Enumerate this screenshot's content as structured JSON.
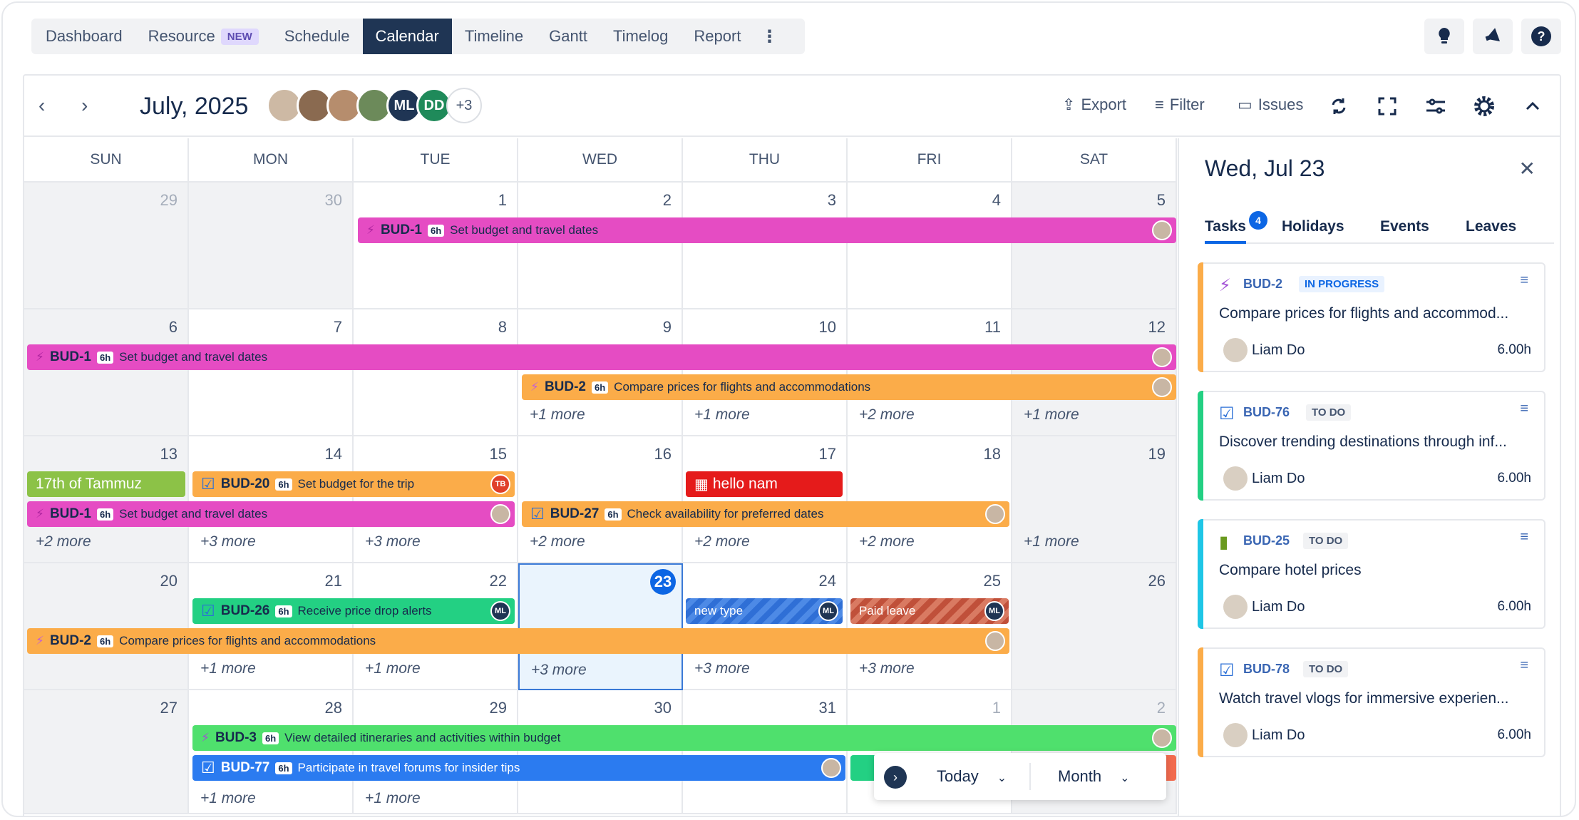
{
  "nav": {
    "items": [
      {
        "label": "Dashboard"
      },
      {
        "label": "Resource",
        "badge": "NEW"
      },
      {
        "label": "Schedule"
      },
      {
        "label": "Calendar",
        "active": true
      },
      {
        "label": "Timeline"
      },
      {
        "label": "Gantt"
      },
      {
        "label": "Timelog"
      },
      {
        "label": "Report"
      }
    ]
  },
  "header": {
    "title": "July, 2025",
    "more_avatars": "+3",
    "avatar_initials": [
      "ML",
      "DD"
    ],
    "export": "Export",
    "filter": "Filter",
    "issues": "Issues"
  },
  "days": [
    "SUN",
    "MON",
    "TUE",
    "WED",
    "THU",
    "FRI",
    "SAT"
  ],
  "weeks": [
    {
      "dates": [
        "29",
        "30",
        "1",
        "2",
        "3",
        "4",
        "5"
      ],
      "more": [
        "",
        "",
        "",
        "",
        "",
        "",
        ""
      ]
    },
    {
      "dates": [
        "6",
        "7",
        "8",
        "9",
        "10",
        "11",
        "12"
      ],
      "more": [
        "",
        "",
        "",
        "+1 more",
        "+1 more",
        "+2 more",
        "+1 more"
      ]
    },
    {
      "dates": [
        "13",
        "14",
        "15",
        "16",
        "17",
        "18",
        "19"
      ],
      "more": [
        "+2 more",
        "+3 more",
        "+3 more",
        "+2 more",
        "+2 more",
        "+2 more",
        "+1 more"
      ]
    },
    {
      "dates": [
        "20",
        "21",
        "22",
        "23",
        "24",
        "25",
        "26"
      ],
      "more": [
        "",
        "+1 more",
        "+1 more",
        "+3 more",
        "+3 more",
        "+3 more",
        ""
      ]
    },
    {
      "dates": [
        "27",
        "28",
        "29",
        "30",
        "31",
        "1",
        "2"
      ],
      "more": [
        "",
        "+1 more",
        "+1 more",
        "",
        "",
        "",
        ""
      ]
    }
  ],
  "events": {
    "e1": {
      "key": "BUD-1",
      "h": "6h",
      "title": "Set budget and travel dates"
    },
    "e2": {
      "key": "BUD-1",
      "h": "6h",
      "title": "Set budget and travel dates"
    },
    "e3": {
      "key": "BUD-2",
      "h": "6h",
      "title": "Compare prices for flights and accommodations"
    },
    "e4": {
      "title": "17th of Tammuz"
    },
    "e5": {
      "key": "BUD-20",
      "h": "6h",
      "title": "Set budget for the trip",
      "av": "TB"
    },
    "e6": {
      "title": "hello nam"
    },
    "e7": {
      "key": "BUD-1",
      "h": "6h",
      "title": "Set budget and travel dates"
    },
    "e8": {
      "key": "BUD-27",
      "h": "6h",
      "title": "Check availability for preferred dates"
    },
    "e9": {
      "key": "BUD-26",
      "h": "6h",
      "title": "Receive price drop alerts",
      "av": "ML"
    },
    "e10": {
      "title": "new type",
      "av": "ML"
    },
    "e11": {
      "title": "Paid leave",
      "av": "ML"
    },
    "e12": {
      "key": "BUD-2",
      "h": "6h",
      "title": "Compare prices for flights and accommodations"
    },
    "e13": {
      "key": "BUD-3",
      "h": "6h",
      "title": "View detailed itineraries and activities within budget"
    },
    "e14": {
      "key": "BUD-77",
      "h": "6h",
      "title": "Participate in travel forums for insider tips"
    }
  },
  "side": {
    "title": "Wed, Jul 23",
    "tabs": [
      "Tasks",
      "Holidays",
      "Events",
      "Leaves"
    ],
    "task_count": "4",
    "cards": [
      {
        "key": "BUD-2",
        "status": "IN PROGRESS",
        "desc": "Compare prices for flights and accommod...",
        "who": "Liam Do",
        "hours": "6.00h",
        "color": "#fbac49"
      },
      {
        "key": "BUD-76",
        "status": "TO DO",
        "desc": "Discover trending destinations through inf...",
        "who": "Liam Do",
        "hours": "6.00h",
        "color": "#23d083"
      },
      {
        "key": "BUD-25",
        "status": "TO DO",
        "desc": "Compare hotel prices",
        "who": "Liam Do",
        "hours": "6.00h",
        "color": "#1fc6e6"
      },
      {
        "key": "BUD-78",
        "status": "TO DO",
        "desc": "Watch travel vlogs for immersive experien...",
        "who": "Liam Do",
        "hours": "6.00h",
        "color": "#fbac49"
      }
    ]
  },
  "float": {
    "today": "Today",
    "month": "Month"
  }
}
